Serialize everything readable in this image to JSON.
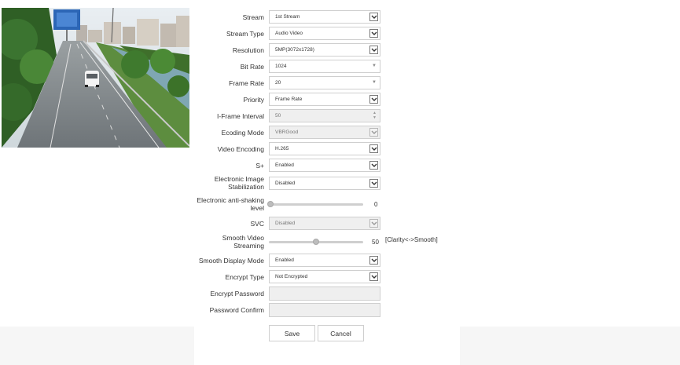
{
  "form": {
    "stream": {
      "label": "Stream",
      "value": "1st Stream"
    },
    "stream_type": {
      "label": "Stream Type",
      "value": "Audio Video"
    },
    "resolution": {
      "label": "Resolution",
      "value": "5MP(3072x1728)"
    },
    "bit_rate": {
      "label": "Bit Rate",
      "value": "1024"
    },
    "frame_rate": {
      "label": "Frame Rate",
      "value": "20"
    },
    "priority": {
      "label": "Priority",
      "value": "Frame Rate"
    },
    "iframe_interval": {
      "label": "I-Frame Interval",
      "value": "50"
    },
    "encoding_mode": {
      "label": "Ecoding Mode",
      "value": "VBRGood"
    },
    "video_encoding": {
      "label": "Video Encoding",
      "value": "H.265"
    },
    "s_plus": {
      "label": "S+",
      "value": "Enabled"
    },
    "eis": {
      "label_line1": "Electronic Image",
      "label_line2": "Stabilization",
      "value": "Disabled"
    },
    "anti_shaking": {
      "label_line1": "Electronic anti-shaking",
      "label_line2": "level",
      "value": "0",
      "level": 0
    },
    "svc": {
      "label": "SVC",
      "value": "Disabled"
    },
    "smooth_streaming": {
      "label_line1": "Smooth Video",
      "label_line2": "Streaming",
      "value": "50",
      "level": 50,
      "hint": "[Clarity<->Smooth]"
    },
    "smooth_display": {
      "label": "Smooth Display Mode",
      "value": "Enabled"
    },
    "encrypt_type": {
      "label": "Encrypt Type",
      "value": "Not Encrypted"
    },
    "encrypt_password": {
      "label": "Encrypt Password",
      "value": ""
    },
    "password_confirm": {
      "label": "Password Confirm",
      "value": ""
    }
  },
  "buttons": {
    "save": "Save",
    "cancel": "Cancel"
  }
}
